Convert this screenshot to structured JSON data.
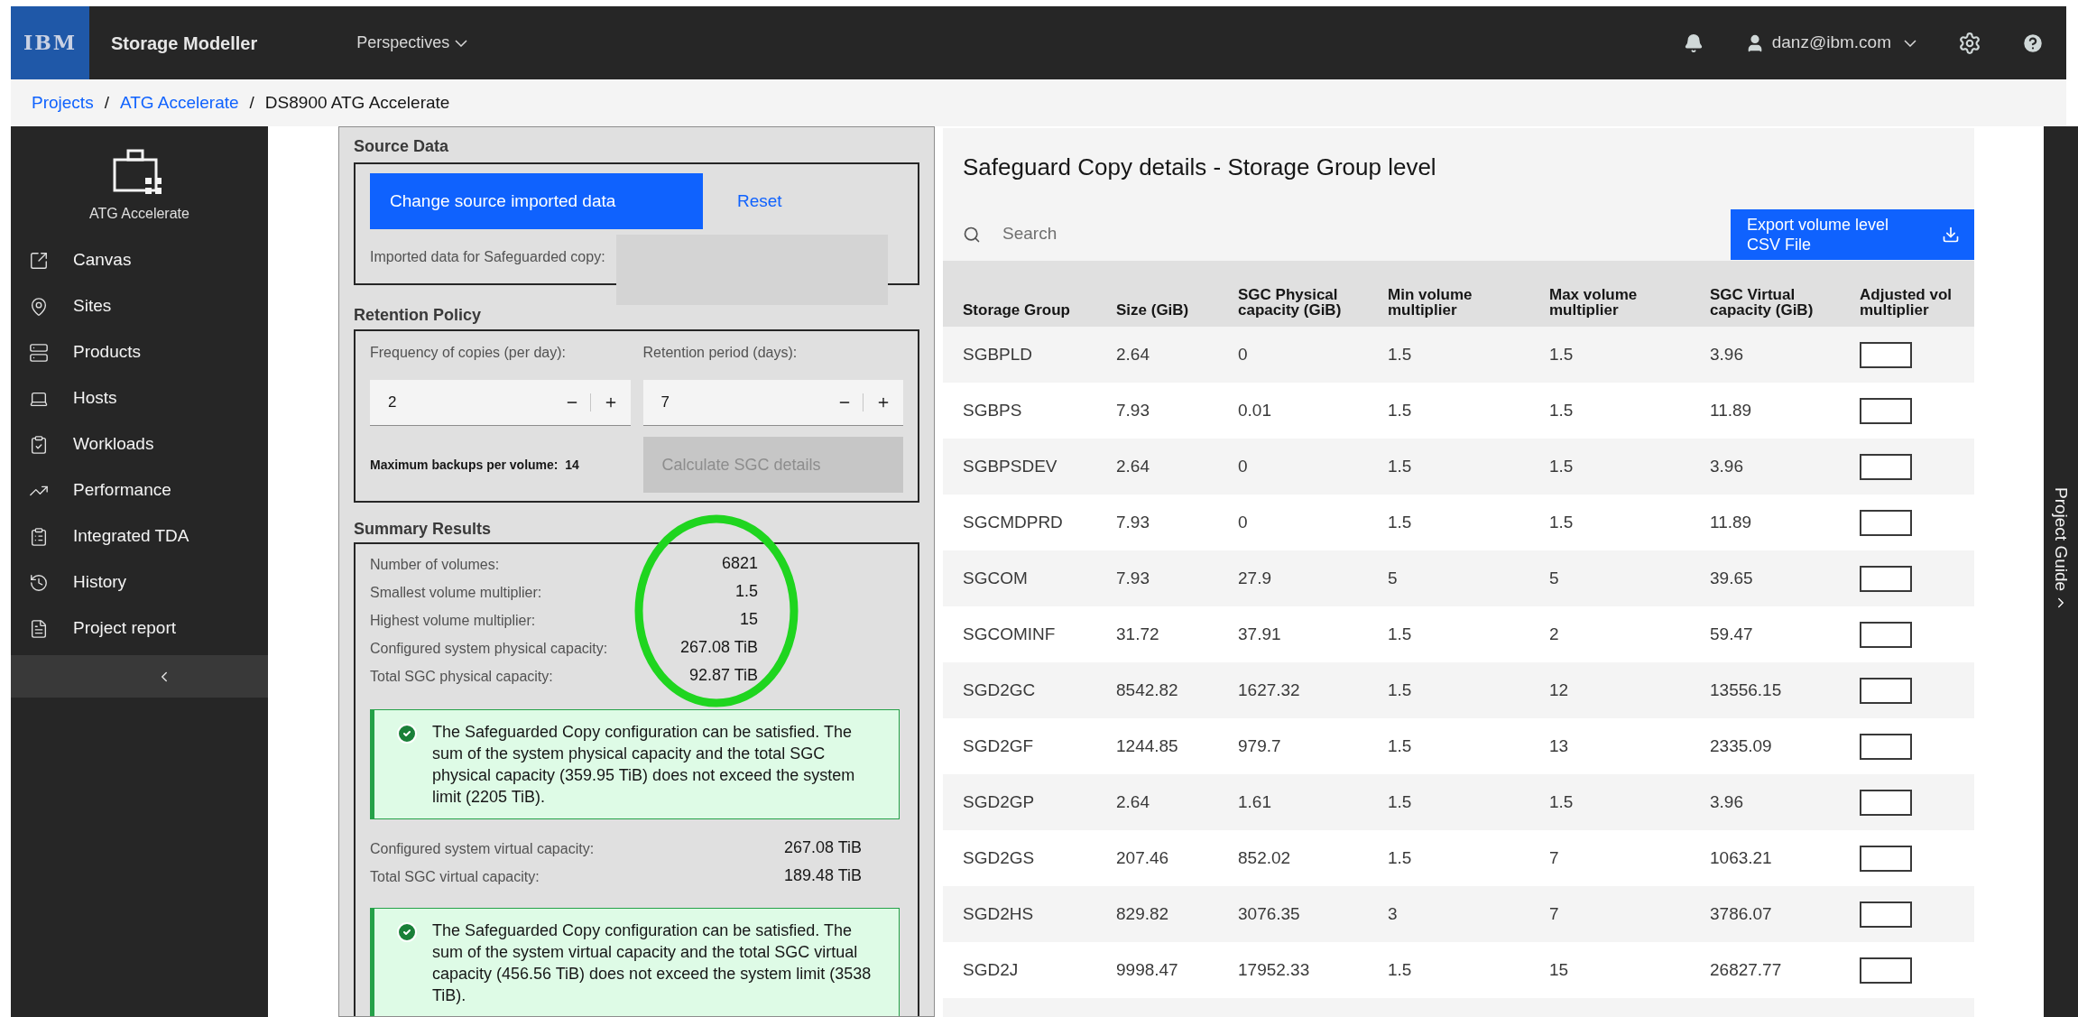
{
  "header": {
    "logo": "IBM",
    "app_title": "Storage Modeller",
    "menu": "Perspectives",
    "user": "danz@ibm.com"
  },
  "breadcrumb": [
    {
      "label": "Projects",
      "link": true
    },
    {
      "label": "ATG Accelerate",
      "link": true,
      "separator": "/"
    },
    {
      "label": "DS8900 ATG Accelerate",
      "link": false,
      "separator": "/"
    }
  ],
  "sidebar": {
    "project": "ATG Accelerate",
    "items": [
      {
        "label": "Canvas"
      },
      {
        "label": "Sites"
      },
      {
        "label": "Products"
      },
      {
        "label": "Hosts"
      },
      {
        "label": "Workloads"
      },
      {
        "label": "Performance"
      },
      {
        "label": "Integrated TDA"
      },
      {
        "label": "History"
      },
      {
        "label": "Project report"
      }
    ]
  },
  "source_data": {
    "title": "Source Data",
    "primary_button": "Change source imported data",
    "reset_button": "Reset",
    "imported_label": "Imported data for Safeguarded copy:"
  },
  "retention": {
    "title": "Retention Policy",
    "fields": [
      {
        "label": "Frequency of copies (per day):",
        "value": "2"
      },
      {
        "label": "Retention period (days):",
        "value": "7"
      }
    ],
    "max_backups_label": "Maximum backups per volume:",
    "max_backups_value": "14",
    "calculate_button": {
      "label": "Calculate SGC details",
      "disabled": true
    }
  },
  "summary": {
    "title": "Summary Results",
    "physical_rows": [
      {
        "label": "Number of volumes:",
        "value": "6821"
      },
      {
        "label": "Smallest volume multiplier:",
        "value": "1.5"
      },
      {
        "label": "Highest volume multiplier:",
        "value": "15"
      },
      {
        "label": "Configured system physical capacity:",
        "value": "267.08 TiB"
      },
      {
        "label": "Total SGC physical capacity:",
        "value": "92.87 TiB"
      }
    ],
    "physical_message": {
      "kind": "success",
      "text": "The Safeguarded Copy configuration can be satisfied. The sum of the system physical capacity and the total SGC physical capacity (359.95 TiB) does not exceed the system limit (2205 TiB)."
    },
    "virtual_rows": [
      {
        "label": "Configured system virtual capacity:",
        "value": "267.08 TiB"
      },
      {
        "label": "Total SGC virtual capacity:",
        "value": "189.48 TiB"
      }
    ],
    "virtual_message": {
      "kind": "success",
      "text": "The Safeguarded Copy configuration can be satisfied. The sum of the system virtual capacity and the total SGC virtual capacity (456.56 TiB) does not exceed the system limit (3538 TiB)."
    }
  },
  "table": {
    "title": "Safeguard Copy details - Storage Group level",
    "search_placeholder": "Search",
    "export_button": "Export volume level CSV File",
    "columns": [
      "Storage Group",
      "Size (GiB)",
      "SGC Physical capacity (GiB)",
      "Min volume multiplier",
      "Max volume multiplier",
      "SGC Virtual capacity (GiB)",
      "Adjusted vol multiplier"
    ],
    "rows": [
      [
        "SGBPLD",
        "2.64",
        "0",
        "1.5",
        "1.5",
        "3.96"
      ],
      [
        "SGBPS",
        "7.93",
        "0.01",
        "1.5",
        "1.5",
        "11.89"
      ],
      [
        "SGBPSDEV",
        "2.64",
        "0",
        "1.5",
        "1.5",
        "3.96"
      ],
      [
        "SGCMDPRD",
        "7.93",
        "0",
        "1.5",
        "1.5",
        "11.89"
      ],
      [
        "SGCOM",
        "7.93",
        "27.9",
        "5",
        "5",
        "39.65"
      ],
      [
        "SGCOMINF",
        "31.72",
        "37.91",
        "1.5",
        "2",
        "59.47"
      ],
      [
        "SGD2GC",
        "8542.82",
        "1627.32",
        "1.5",
        "12",
        "13556.15"
      ],
      [
        "SGD2GF",
        "1244.85",
        "979.7",
        "1.5",
        "13",
        "2335.09"
      ],
      [
        "SGD2GP",
        "2.64",
        "1.61",
        "1.5",
        "1.5",
        "3.96"
      ],
      [
        "SGD2GS",
        "207.46",
        "852.02",
        "1.5",
        "7",
        "1063.21"
      ],
      [
        "SGD2HS",
        "829.82",
        "3076.35",
        "3",
        "7",
        "3786.07"
      ],
      [
        "SGD2J",
        "9998.47",
        "17952.33",
        "1.5",
        "15",
        "26827.77"
      ]
    ]
  },
  "project_guide": "Project Guide"
}
